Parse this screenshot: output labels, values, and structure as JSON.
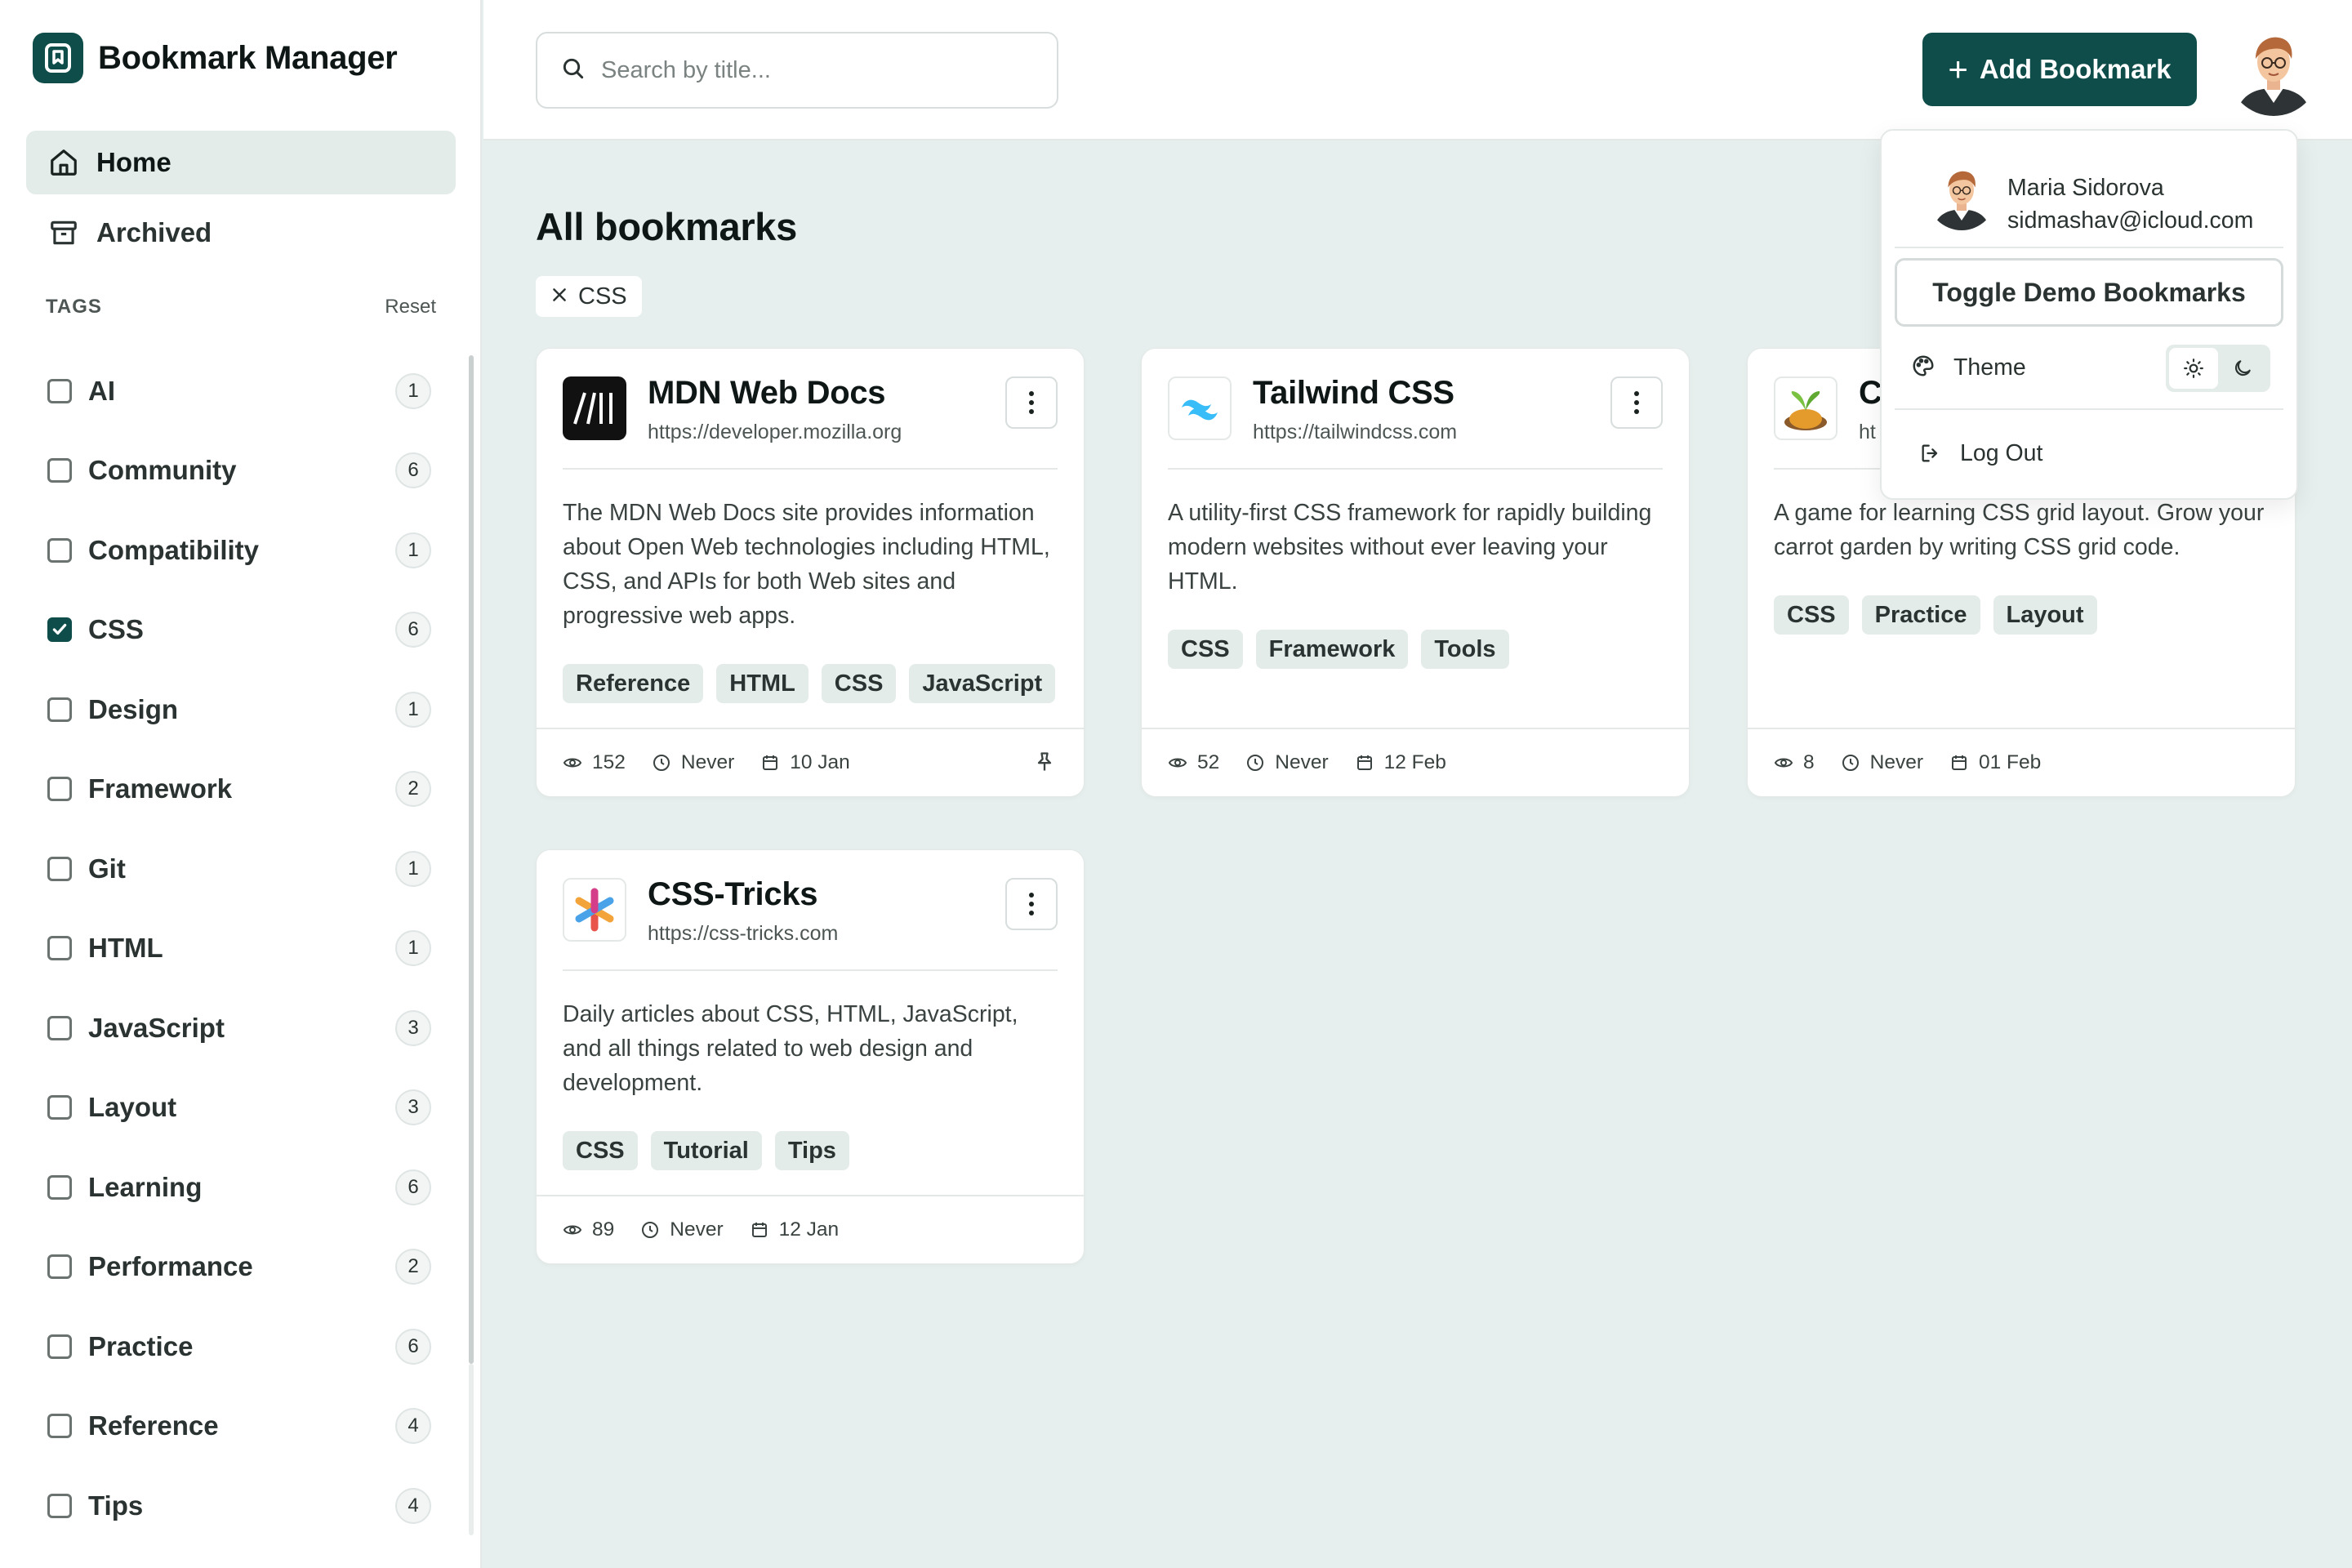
{
  "app": {
    "title": "Bookmark Manager"
  },
  "nav": [
    {
      "label": "Home",
      "active": true,
      "icon": "home-icon"
    },
    {
      "label": "Archived",
      "active": false,
      "icon": "archive-icon"
    }
  ],
  "tags": {
    "title": "TAGS",
    "reset_label": "Reset",
    "items": [
      {
        "label": "AI",
        "count": "1",
        "checked": false
      },
      {
        "label": "Community",
        "count": "6",
        "checked": false
      },
      {
        "label": "Compatibility",
        "count": "1",
        "checked": false
      },
      {
        "label": "CSS",
        "count": "6",
        "checked": true
      },
      {
        "label": "Design",
        "count": "1",
        "checked": false
      },
      {
        "label": "Framework",
        "count": "2",
        "checked": false
      },
      {
        "label": "Git",
        "count": "1",
        "checked": false
      },
      {
        "label": "HTML",
        "count": "1",
        "checked": false
      },
      {
        "label": "JavaScript",
        "count": "3",
        "checked": false
      },
      {
        "label": "Layout",
        "count": "3",
        "checked": false
      },
      {
        "label": "Learning",
        "count": "6",
        "checked": false
      },
      {
        "label": "Performance",
        "count": "2",
        "checked": false
      },
      {
        "label": "Practice",
        "count": "6",
        "checked": false
      },
      {
        "label": "Reference",
        "count": "4",
        "checked": false
      },
      {
        "label": "Tips",
        "count": "4",
        "checked": false
      }
    ]
  },
  "header": {
    "search_placeholder": "Search by title...",
    "add_label": "Add Bookmark"
  },
  "main": {
    "title": "All bookmarks",
    "active_filter": "CSS"
  },
  "cards": [
    {
      "title": "MDN Web Docs",
      "url": "https://developer.mozilla.org",
      "description": "The MDN Web Docs site provides information about Open Web technologies including HTML, CSS, and APIs for both Web sites and progressive web apps.",
      "tags": [
        "Reference",
        "HTML",
        "CSS",
        "JavaScript"
      ],
      "views": "152",
      "last_visited": "Never",
      "added": "10 Jan",
      "pinned": true,
      "favicon": "mdn-logo"
    },
    {
      "title": "Tailwind CSS",
      "url": "https://tailwindcss.com",
      "description": "A utility-first CSS framework for rapidly building modern websites without ever leaving your HTML.",
      "tags": [
        "CSS",
        "Framework",
        "Tools"
      ],
      "views": "52",
      "last_visited": "Never",
      "added": "12 Feb",
      "pinned": false,
      "favicon": "tailwind-logo"
    },
    {
      "title": "C",
      "url": "ht",
      "description": "A game for learning CSS grid layout. Grow your carrot garden by writing CSS grid code.",
      "tags": [
        "CSS",
        "Practice",
        "Layout"
      ],
      "views": "8",
      "last_visited": "Never",
      "added": "01 Feb",
      "pinned": false,
      "favicon": "grid-garden-logo"
    },
    {
      "title": "CSS-Tricks",
      "url": "https://css-tricks.com",
      "description": "Daily articles about CSS, HTML, JavaScript, and all things related to web design and development.",
      "tags": [
        "CSS",
        "Tutorial",
        "Tips"
      ],
      "views": "89",
      "last_visited": "Never",
      "added": "12 Jan",
      "pinned": false,
      "favicon": "css-tricks-logo"
    }
  ],
  "user_menu": {
    "name": "Maria Sidorova",
    "email": "sidmashav@icloud.com",
    "toggle_demo_label": "Toggle Demo Bookmarks",
    "theme_label": "Theme",
    "theme_selected": "light",
    "logout_label": "Log Out"
  },
  "colors": {
    "accent": "#0e4d49",
    "background": "#e6efed",
    "chip": "#e4ecea"
  }
}
